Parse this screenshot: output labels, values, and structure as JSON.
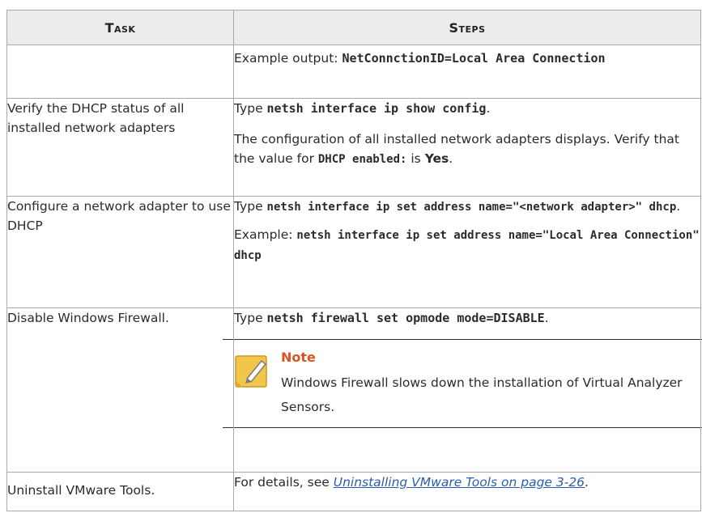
{
  "header": {
    "task": "Task",
    "steps": "Steps"
  },
  "rows": [
    {
      "task": "",
      "example_prefix": "Example output: ",
      "example_code": "NetConnctionID=Local Area Connection"
    },
    {
      "task": "Verify the DHCP status of all installed network adapters",
      "type_prefix": "Type ",
      "command": "netsh interface ip show config",
      "period": ".",
      "desc_prefix": "The configuration of all installed network adapters displays. Verify that the value for ",
      "desc_code": "DHCP enabled:",
      "desc_mid": " is ",
      "desc_value": "Yes",
      "desc_end": "."
    },
    {
      "task": "Configure a network adapter to use DHCP",
      "type_prefix": "Type ",
      "command": "netsh interface ip set address name=\"<network adapter>\" dhcp",
      "period": ".",
      "example_prefix": "Example: ",
      "example_code": "netsh interface ip set address name=\"Local Area Connection\" dhcp"
    },
    {
      "task": "Disable Windows Firewall.",
      "type_prefix": "Type ",
      "command": "netsh firewall set opmode mode=DISABLE",
      "period": ".",
      "note_title": "Note",
      "note_text": "Windows Firewall slows down the installation of Virtual Analyzer Sensors."
    },
    {
      "task": "Uninstall VMware Tools.",
      "details_prefix": "For details, see ",
      "link_text": "Uninstalling VMware Tools on page 3-26",
      "details_end": "."
    }
  ],
  "colors": {
    "header_bg": "#ececec",
    "border": "#a9a9a9",
    "note_title": "#d9541e",
    "link": "#2a5db0",
    "note_icon": "#f2c64a"
  },
  "icons": {
    "note": "note-pencil-icon"
  }
}
